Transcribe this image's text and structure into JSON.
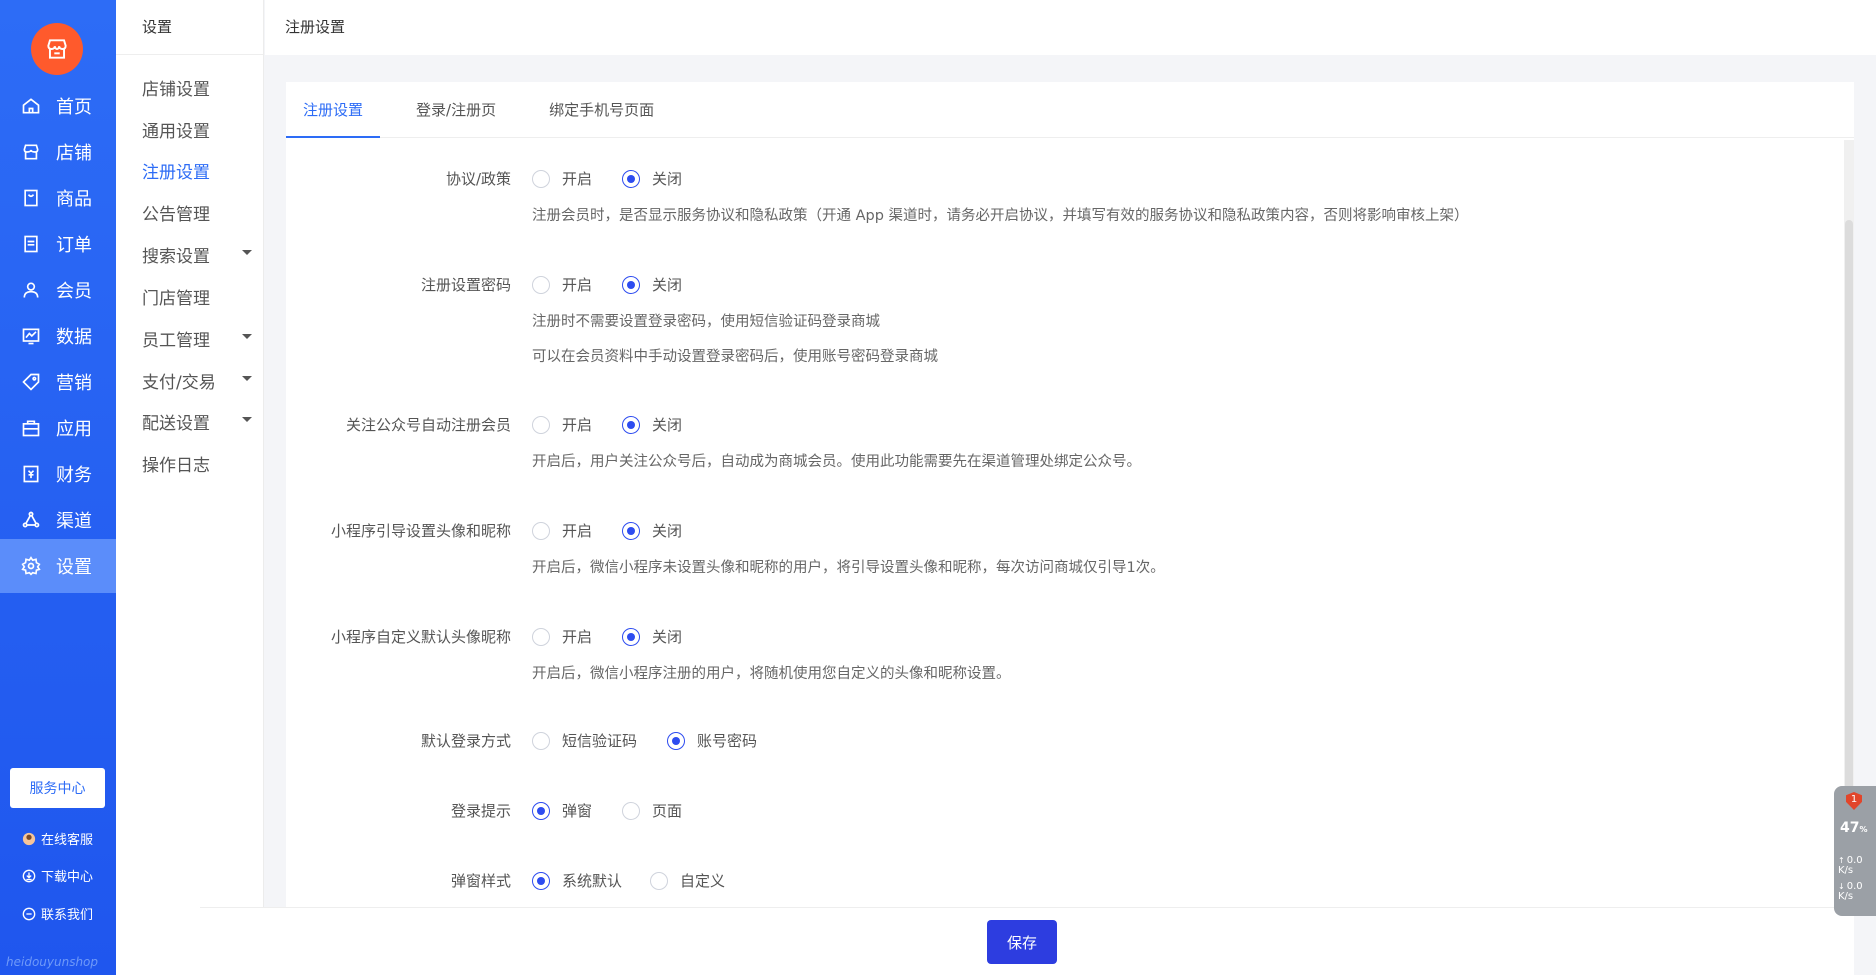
{
  "rail": {
    "items": [
      {
        "label": "首页",
        "icon": "home-icon"
      },
      {
        "label": "店铺",
        "icon": "store-icon"
      },
      {
        "label": "商品",
        "icon": "goods-icon"
      },
      {
        "label": "订单",
        "icon": "order-icon"
      },
      {
        "label": "会员",
        "icon": "member-icon"
      },
      {
        "label": "数据",
        "icon": "chart-icon"
      },
      {
        "label": "营销",
        "icon": "tag-icon"
      },
      {
        "label": "应用",
        "icon": "app-icon"
      },
      {
        "label": "财务",
        "icon": "finance-icon"
      },
      {
        "label": "渠道",
        "icon": "channel-icon"
      },
      {
        "label": "设置",
        "icon": "gear-icon"
      }
    ],
    "service_center": "服务中心",
    "links": [
      {
        "label": "在线客服",
        "icon": "avatar-icon"
      },
      {
        "label": "下载中心",
        "icon": "download-icon"
      },
      {
        "label": "联系我们",
        "icon": "chat-icon"
      }
    ],
    "watermark": "heidouyunshop"
  },
  "submenu": {
    "title": "设置",
    "items": [
      {
        "label": "店铺设置"
      },
      {
        "label": "通用设置"
      },
      {
        "label": "注册设置"
      },
      {
        "label": "公告管理"
      },
      {
        "label": "搜索设置"
      },
      {
        "label": "门店管理"
      },
      {
        "label": "员工管理"
      },
      {
        "label": "支付/交易"
      },
      {
        "label": "配送设置"
      },
      {
        "label": "操作日志"
      }
    ]
  },
  "topbar": {
    "title": "注册设置"
  },
  "tabs": [
    "注册设置",
    "登录/注册页",
    "绑定手机号页面"
  ],
  "form": {
    "rows": [
      {
        "label": "协议/政策",
        "options": [
          "开启",
          "关闭"
        ],
        "selected": "关闭",
        "hints": [
          "注册会员时，是否显示服务协议和隐私政策（开通 App 渠道时，请务必开启协议，并填写有效的服务协议和隐私政策内容，否则将影响审核上架）"
        ]
      },
      {
        "label": "注册设置密码",
        "options": [
          "开启",
          "关闭"
        ],
        "selected": "关闭",
        "hints": [
          "注册时不需要设置登录密码，使用短信验证码登录商城",
          "可以在会员资料中手动设置登录密码后，使用账号密码登录商城"
        ]
      },
      {
        "label": "关注公众号自动注册会员",
        "options": [
          "开启",
          "关闭"
        ],
        "selected": "关闭",
        "hints": [
          "开启后，用户关注公众号后，自动成为商城会员。使用此功能需要先在渠道管理处绑定公众号。"
        ]
      },
      {
        "label": "小程序引导设置头像和昵称",
        "options": [
          "开启",
          "关闭"
        ],
        "selected": "关闭",
        "hints": [
          "开启后，微信小程序未设置头像和昵称的用户，将引导设置头像和昵称，每次访问商城仅引导1次。"
        ]
      },
      {
        "label": "小程序自定义默认头像昵称",
        "options": [
          "开启",
          "关闭"
        ],
        "selected": "关闭",
        "hints": [
          "开启后，微信小程序注册的用户，将随机使用您自定义的头像和昵称设置。"
        ]
      },
      {
        "label": "默认登录方式",
        "options": [
          "短信验证码",
          "账号密码"
        ],
        "selected": "账号密码",
        "hints": []
      },
      {
        "label": "登录提示",
        "options": [
          "弹窗",
          "页面"
        ],
        "selected": "弹窗",
        "hints": []
      },
      {
        "label": "弹窗样式",
        "options": [
          "系统默认",
          "自定义"
        ],
        "selected": "系统默认",
        "hints": []
      }
    ]
  },
  "save_label": "保存",
  "widget": {
    "badge": "1",
    "percent": "47",
    "percent_unit": "%",
    "up": "0.0",
    "down": "0.0",
    "unit": "K/s"
  },
  "colors": {
    "primary": "#2d6cf6",
    "logo": "#ff5a2c",
    "radio": "#2d4cf0",
    "save": "#2d3de0"
  }
}
